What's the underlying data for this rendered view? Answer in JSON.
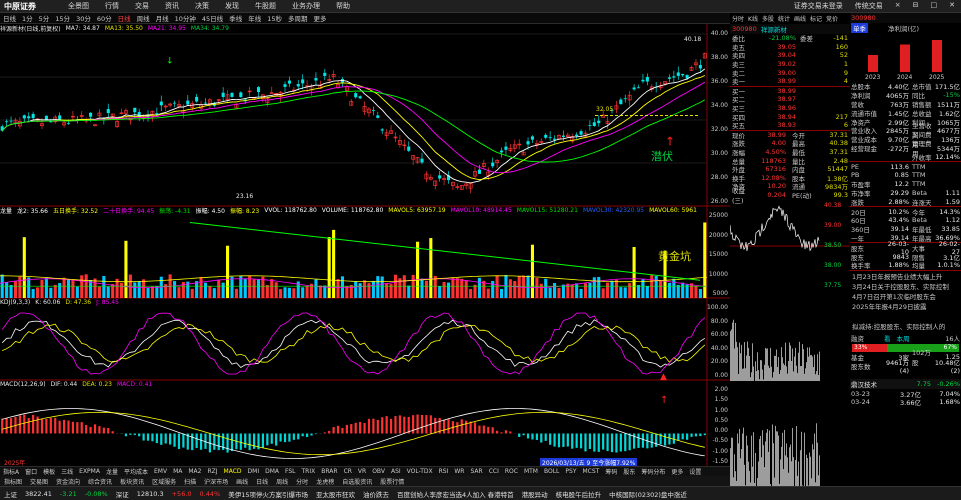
{
  "app": {
    "logo": "中原证券",
    "menu": [
      "全景图",
      "行情",
      "交易",
      "资讯",
      "决策",
      "发现",
      "牛股题",
      "业务办理",
      "帮助"
    ],
    "right": [
      "证券交易未登录",
      "传统交易",
      "×",
      "⊟",
      "□",
      "✕"
    ]
  },
  "period": {
    "items": [
      "日线",
      "1分",
      "5分",
      "15分",
      "30分",
      "60分",
      "日线",
      "周线",
      "月线",
      "10分钟",
      "45日线",
      "季线",
      "年线",
      "15秒",
      "多周期",
      "更多"
    ],
    "selected_index": 6
  },
  "toolbar_right": [
    "分时",
    "K线",
    "多股",
    "统计",
    "画线",
    "标记",
    "竞价"
  ],
  "price_panel": {
    "header": "祥源新材(日线,前复权)",
    "ma5": "MA7: 34.87",
    "ma13": "MA13: 35.50",
    "ma21": "MA21: 34.95",
    "ma34": "MA34: 34.79",
    "hi_label": "40.18",
    "lo_label": "23.16",
    "mid_label": "32.05",
    "note": "潜伏",
    "axis": [
      "40.00",
      "38.00",
      "36.00",
      "34.00",
      "32.00",
      "30.00",
      "28.00",
      "26.00"
    ]
  },
  "vol_panel": {
    "header": [
      "龙量",
      "龙2: 35.66",
      "五日换手: 32.52",
      "二十日换手: 94.45",
      "振荡: -4.31",
      "振幅: 4.50",
      "振幅: 8.23",
      "VVOL: 118762.80",
      "VOLUME: 118762.80",
      "MAVOL5: 63957.19",
      "MAVOL10: 48914.45",
      "MAVOL15: 51280.21",
      "MAVOL30: 42320.95",
      "MAVOL60: 5961"
    ],
    "note": "黄金坑",
    "axis": [
      "25000",
      "20000",
      "15000",
      "10000",
      "5000"
    ]
  },
  "kdj_panel": {
    "header": [
      "KDJ(9,3,3)",
      "K: 60.06",
      "D: 47.36",
      "J: 85.45"
    ],
    "axis": [
      "100.00",
      "80.00",
      "60.00",
      "40.00",
      "20.00",
      "0.00"
    ]
  },
  "macd_panel": {
    "header": [
      "MACD(12,26,9)",
      "DIF: 0.44",
      "DEA: 0.23",
      "MACD: 0.41"
    ],
    "axis": [
      "2.00",
      "1.50",
      "1.00",
      "0.50",
      "0.00",
      "-0.50",
      "-1.00",
      "-1.50"
    ],
    "date_tip": "2026/03/13/五 9 至今涨幅7.92%",
    "year": "2025年"
  },
  "indicator_tabs": [
    "指标A",
    "窗口",
    "模板",
    "三线",
    "EXPMA",
    "龙量",
    "平均成本",
    "EMV",
    "MA",
    "MA2",
    "RZJ",
    "MACD",
    "DMI",
    "DMA",
    "FSL",
    "TRIX",
    "BRAR",
    "CR",
    "VR",
    "OBV",
    "ASI",
    "VOL-TDX",
    "RSI",
    "WR",
    "SAR",
    "CCI",
    "ROC",
    "MTM",
    "BOLL",
    "PSY",
    "MCST",
    "筹码",
    "股东",
    "筹码分布",
    "更多",
    "设置"
  ],
  "dock": [
    "指标图",
    "交易图",
    "资金流向",
    "综合资讯",
    "板块资讯",
    "区域服务",
    "扫描",
    "沪深市场",
    "画线",
    "日线",
    "周线",
    "分时",
    "龙虎榜",
    "自选股资讯",
    "股票行情"
  ],
  "quote": {
    "code": "300980",
    "name": "祥源新材",
    "ratio_label": "委比",
    "ratio": "-21.08%",
    "diff_label": "委差",
    "diff": "-141",
    "asks": [
      {
        "l": "卖五",
        "p": "39.05",
        "v": "160"
      },
      {
        "l": "卖四",
        "p": "39.04",
        "v": "52"
      },
      {
        "l": "卖三",
        "p": "39.02",
        "v": "1"
      },
      {
        "l": "卖二",
        "p": "39.00",
        "v": "9"
      },
      {
        "l": "卖一",
        "p": "38.99",
        "v": "4"
      }
    ],
    "bids": [
      {
        "l": "买一",
        "p": "38.99",
        "v": ""
      },
      {
        "l": "买二",
        "p": "38.97",
        "v": ""
      },
      {
        "l": "买三",
        "p": "38.96",
        "v": ""
      },
      {
        "l": "买四",
        "p": "38.94",
        "v": "217"
      },
      {
        "l": "买五",
        "p": "38.93",
        "v": "6"
      }
    ],
    "stats": [
      [
        "现价",
        "38.99",
        "今开",
        "37.31"
      ],
      [
        "涨跌",
        "4.00",
        "最高",
        "40.38"
      ],
      [
        "涨幅",
        "4.50%",
        "最低",
        "37.31"
      ],
      [
        "总量",
        "118763",
        "量比",
        "2.48"
      ],
      [
        "外盘",
        "67316",
        "内盘",
        "51447"
      ],
      [
        "换手",
        "12.08%",
        "股本",
        "1.38亿"
      ],
      [
        "净资",
        "10.20",
        "流通",
        "9834万"
      ],
      [
        "收益(三)",
        "0.204",
        "PE(动)",
        "99.3"
      ]
    ],
    "mini_axis": [
      "40.38",
      "39.00",
      "38.50",
      "38.00",
      "37.75"
    ]
  },
  "fin": {
    "code": "300980",
    "tabs": [
      "单季",
      "净利润(亿)"
    ],
    "years": [
      "2023",
      "2024",
      "2025"
    ],
    "bar_vals": [
      "0.57",
      "0.92",
      "1.07"
    ],
    "rows": [
      [
        "总股本",
        "4.40亿",
        "总市值",
        "171.5亿"
      ],
      [
        "净利润",
        "4065万",
        "同比",
        "-15%"
      ],
      [
        "营收",
        "763万",
        "销售额",
        "1511万"
      ],
      [
        "流通市值",
        "1.45亿",
        "总收益",
        "1.62亿"
      ],
      [
        "净资产",
        "2.99亿",
        "利润",
        "1065万"
      ],
      [
        "营业收入",
        "2845万",
        "主营收入",
        "4677万"
      ],
      [
        "营业成本",
        "9.70亿",
        "期间费用",
        "136万"
      ],
      [
        "经营现金",
        "-272万",
        "管理费用",
        "5344万"
      ],
      [
        "",
        "",
        "外收率",
        "12.14%"
      ]
    ],
    "rows2": [
      [
        "PE",
        "113.6",
        "TTM",
        ""
      ],
      [
        "PB",
        "0.85",
        "TTM",
        ""
      ],
      [
        "市盈率",
        "12.2",
        "TTM",
        ""
      ],
      [
        "市净率",
        "29.29",
        "Beta",
        "1.11"
      ],
      [
        "涨跌",
        "2.88%",
        "连涨天",
        "1.59"
      ]
    ],
    "rows3": [
      [
        "20日",
        "10.2%",
        "今年",
        "14.3%"
      ],
      [
        "60日",
        "43.4%",
        "Beta",
        "1.12"
      ],
      [
        "360日",
        "39.14",
        "年最低",
        "33.85"
      ],
      [
        "一年",
        "39.14",
        "年最高",
        "36.69%"
      ]
    ],
    "dates": [
      [
        "股东",
        "26-03-10",
        "大事",
        "26-02-27"
      ],
      [
        "股东",
        "9843",
        "限售",
        "3.1亿"
      ],
      [
        "换手率",
        "1.88%",
        "均量",
        "1.0.1%"
      ]
    ],
    "news": [
      "1月23日年报预告业绩大幅上升",
      "3月24日关于控股股东、实际控制",
      "4月7日召开第1次临时股东会",
      "2025年年报4月29日披露",
      "",
      "拟减持:控股股东、实际控制人的"
    ],
    "bars": {
      "label": "融资",
      "tab1": "看",
      "tab2": "本周",
      "val": "16人",
      "buy_pct": "33%",
      "sell_pct": "67%"
    },
    "holders": [
      [
        "基金",
        "3家",
        "102万股",
        "1.25"
      ],
      [
        "股东数",
        "9461万(4)",
        "",
        "10.48亿(2)"
      ],
      [
        "",
        "",
        "",
        ""
      ]
    ],
    "concept": {
      "name": "鼎汉技术",
      "price": "7.75",
      "pct": "-0.26%"
    },
    "flow": [
      [
        "03-23",
        "3.27亿",
        "7.04%"
      ],
      [
        "03-24",
        "3.66亿",
        "1.68%"
      ]
    ]
  },
  "ticker": [
    "上证",
    "3822.41",
    "-3.21",
    "-0.08%",
    "深证",
    "12810.3",
    "+56.0",
    "0.44%",
    "美伊15项停火方案引爆市场",
    "亚太股市狂欢",
    "油价跌去",
    "百度创始人李彦宏当选4人加入 春港特首",
    "港股异动",
    "核电股午后拉升",
    "中核国际(02302)盘中涨近"
  ],
  "colors": {
    "up": "#ff3232",
    "down": "#00e5e5",
    "ma5": "#ffffff",
    "ma13": "#ffff00",
    "ma21": "#ff00ff",
    "ma34": "#00ff00"
  }
}
